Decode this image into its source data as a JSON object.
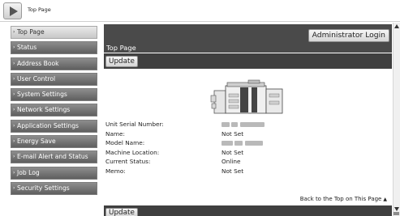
{
  "top_bar": {
    "title": "Top Page",
    "home_icon": "play-triangle-icon"
  },
  "sidebar": {
    "items": [
      {
        "label": "Top Page",
        "active": true
      },
      {
        "label": "Status",
        "active": false
      },
      {
        "label": "Address Book",
        "active": false
      },
      {
        "label": "User Control",
        "active": false
      },
      {
        "label": "System Settings",
        "active": false
      },
      {
        "label": "Network Settings",
        "active": false
      },
      {
        "label": "Application Settings",
        "active": false
      },
      {
        "label": "Energy Save",
        "active": false
      },
      {
        "label": "E-mail Alert and Status",
        "active": false
      },
      {
        "label": "Job Log",
        "active": false
      },
      {
        "label": "Security Settings",
        "active": false
      }
    ],
    "arrow_glyph": "›"
  },
  "main": {
    "page_title": "Top Page",
    "admin_login_label": "Administrator Login",
    "update_label": "Update",
    "info": [
      {
        "label": "Unit Serial Number:",
        "value": ""
      },
      {
        "label": "Name:",
        "value": "Not Set"
      },
      {
        "label": "Model Name:",
        "value": ""
      },
      {
        "label": "Machine Location:",
        "value": "Not Set"
      },
      {
        "label": "Current Status:",
        "value": "Online"
      },
      {
        "label": "Memo:",
        "value": "Not Set"
      }
    ],
    "back_to_top_label": "Back to the Top on This Page",
    "back_to_top_icon": "▲",
    "bottom_update_label": "Update"
  },
  "colors": {
    "header_dark": "#4a4a4a",
    "sidebar_item": "#6f6f6f",
    "sidebar_active": "#dcdcdc"
  }
}
